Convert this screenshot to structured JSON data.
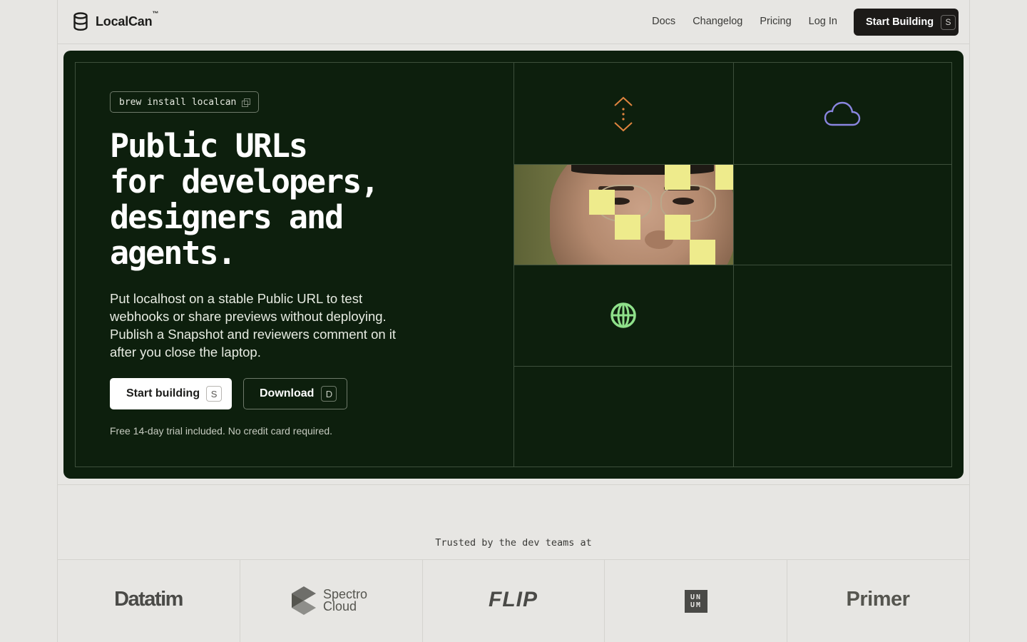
{
  "header": {
    "brand": "LocalCan",
    "brand_tm": "™",
    "nav": [
      "Docs",
      "Changelog",
      "Pricing",
      "Log In"
    ],
    "cta_label": "Start Building",
    "cta_key": "S"
  },
  "hero": {
    "command": "brew install localcan",
    "headline": "Public URLs\nfor developers,\ndesigners and\nagents.",
    "subtext": "Put localhost on a stable Public URL to test webhooks or share previews without deploying. Publish a Snapshot and reviewers comment on it after you close the laptop.",
    "primary_label": "Start building",
    "primary_key": "S",
    "secondary_label": "Download",
    "secondary_key": "D",
    "note": "Free 14-day trial included. No credit card required."
  },
  "trusted": {
    "title": "Trusted by the dev teams at",
    "logos": [
      "Datatim",
      "Spectro",
      "Cloud",
      "FLIP",
      "UN",
      "UM",
      "Primer"
    ]
  },
  "colors": {
    "hero_bg": "#0d1f0d",
    "accent_orange": "#e0843f",
    "accent_purple": "#8a86e0",
    "accent_green": "#8fe08a",
    "pixel_yellow": "#eeeb8c"
  },
  "icons": [
    "database-icon",
    "copy-icon",
    "expand-vertical-icon",
    "cloud-icon",
    "globe-icon"
  ]
}
